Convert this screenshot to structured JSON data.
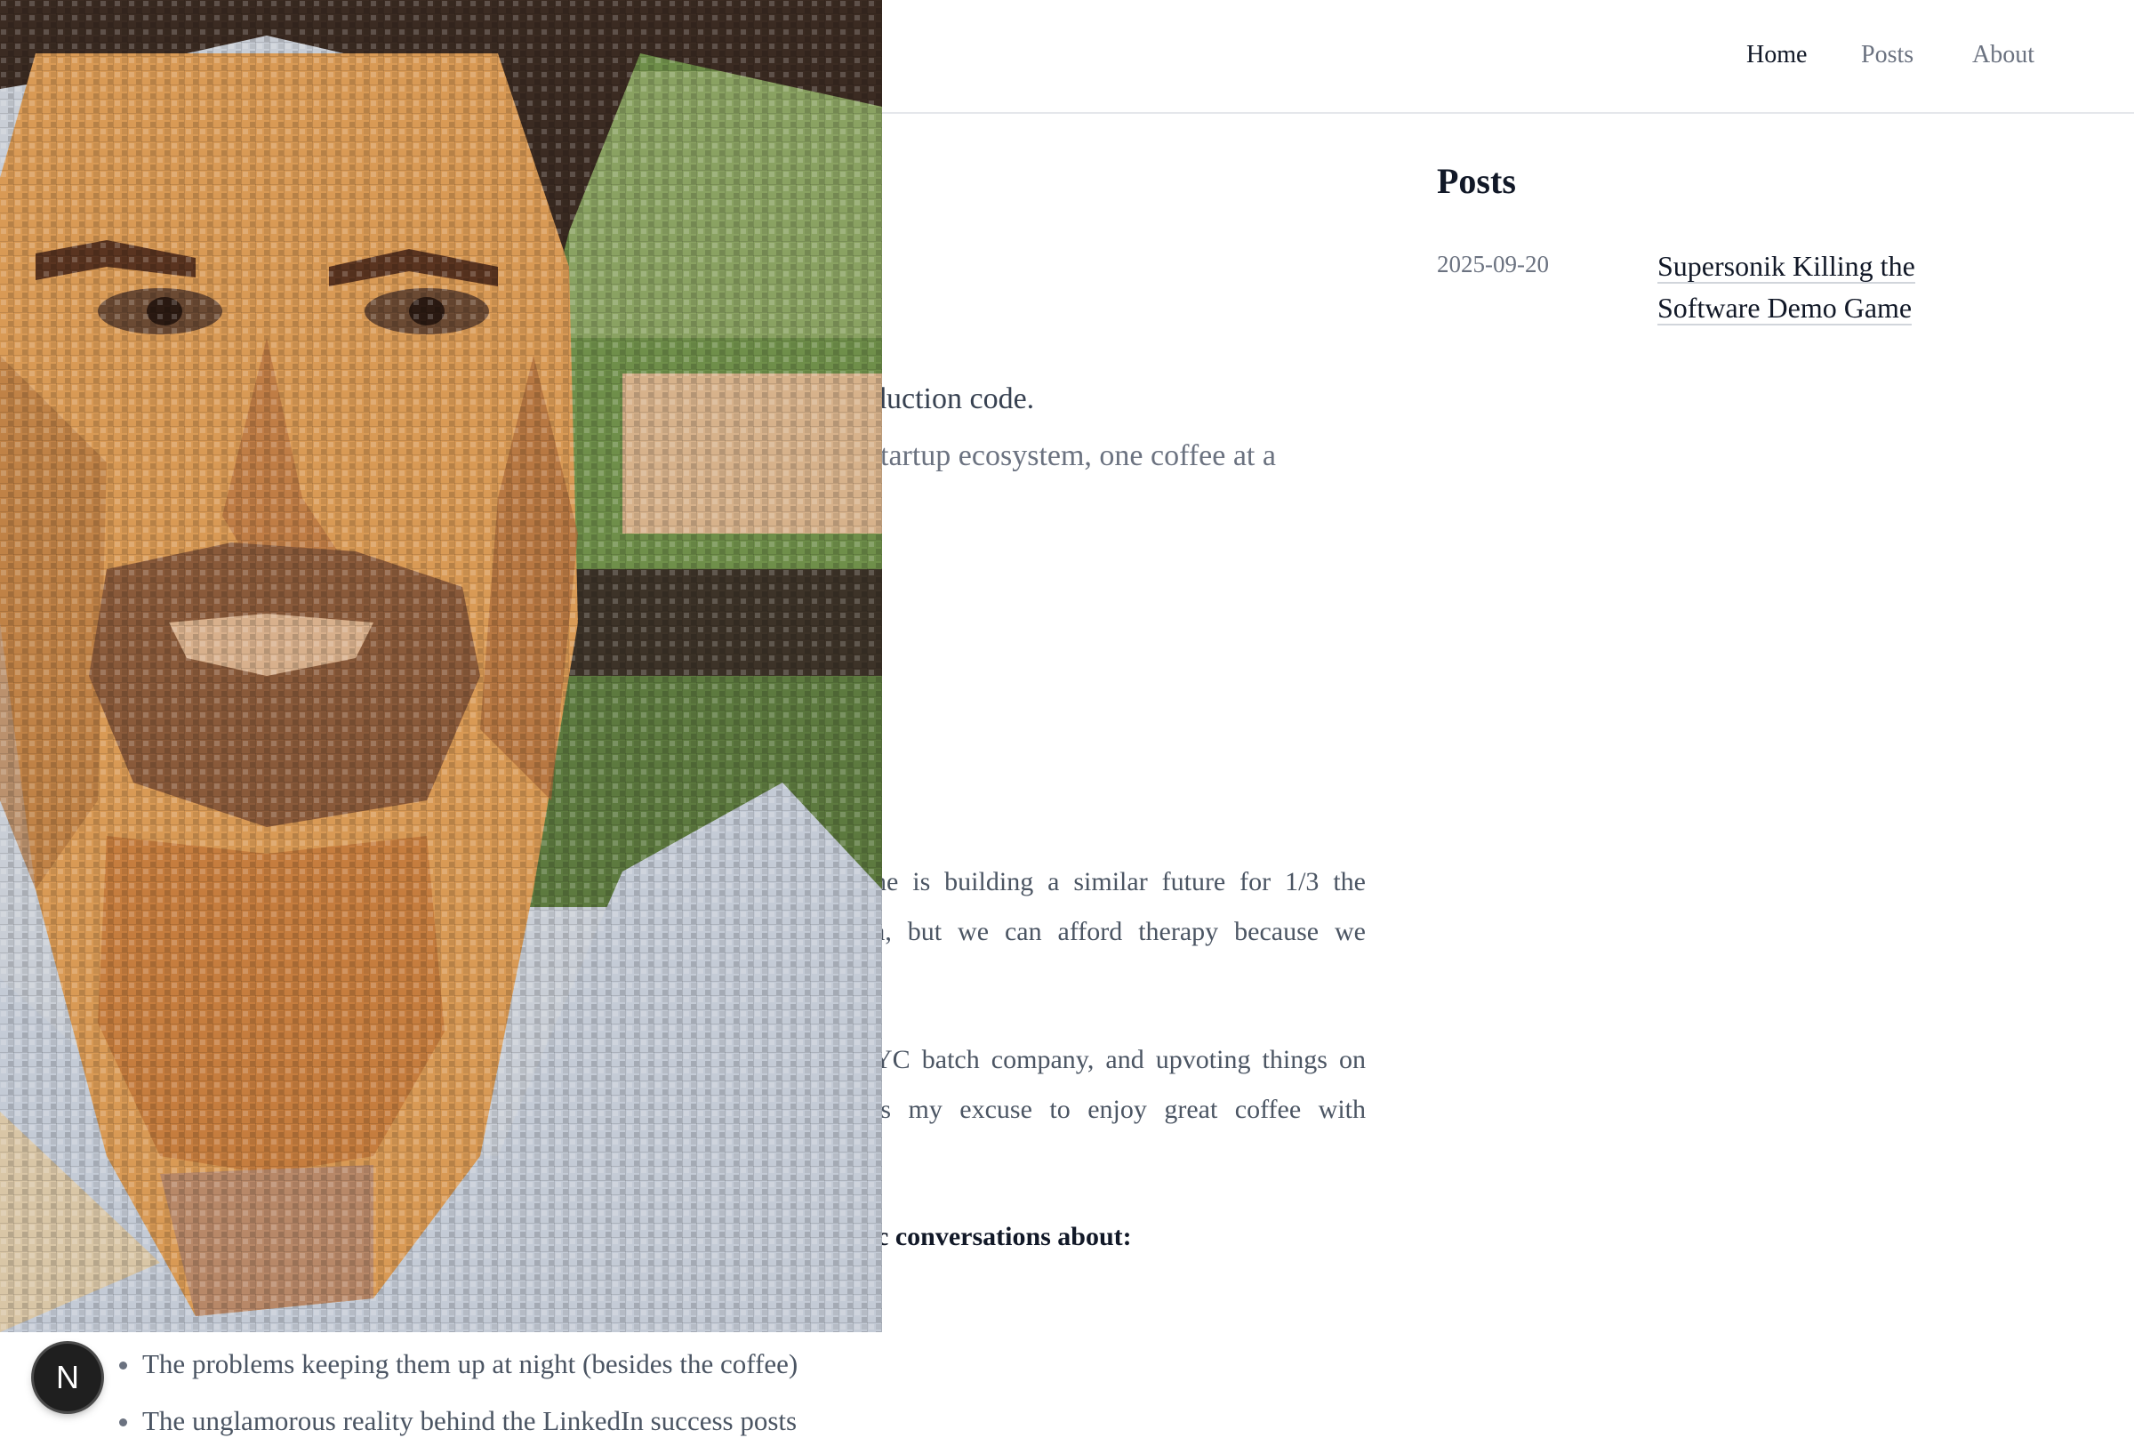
{
  "nav": {
    "home": "Home",
    "posts": "Posts",
    "about": "About"
  },
  "main": {
    "lead_fragment": "duction code.",
    "sub_fragment": "tartup ecosystem, one coffee at a",
    "para1": [
      "ne is building a similar future for 1/3 the",
      "a, but we can afford therapy because we"
    ],
    "para2": [
      "YC batch company, and upvoting things on",
      "is my excuse to enjoy great coffee with"
    ],
    "bold_fragment": "c conversations about:",
    "bullets": [
      "The problems keeping them up at night (besides the coffee)",
      "The unglamorous reality behind the LinkedIn success posts"
    ]
  },
  "sidebar": {
    "title": "Posts",
    "posts": [
      {
        "date": "2025-09-20",
        "title": "Supersonik Killing the Software Demo Game"
      }
    ]
  },
  "badge": {
    "label": "N"
  },
  "colors": {
    "text": "#4b5563",
    "heading": "#111827",
    "muted": "#6b7280",
    "divider": "#e5e7eb"
  }
}
